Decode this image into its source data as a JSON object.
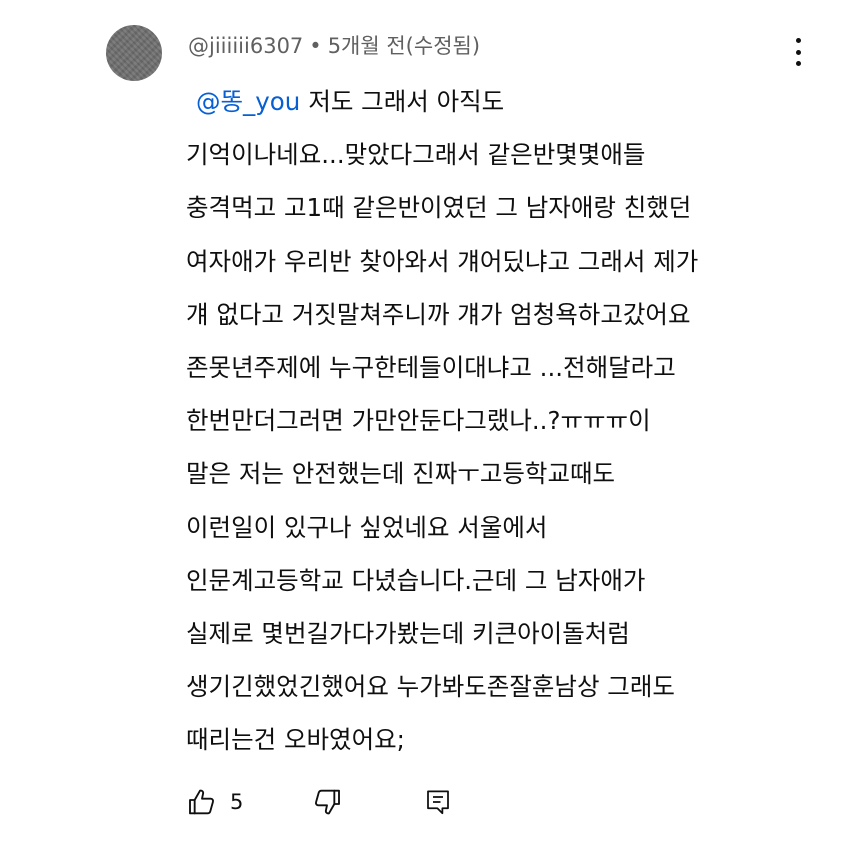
{
  "comment": {
    "author": "@jiiiiii6307",
    "separator": "•",
    "time": "5개월 전(수정됨)",
    "mention": "@똥_you",
    "first_line": "저도 그래서 아직도",
    "lines": [
      "기억이나네요...맞았다그래서 같은반몇몇애들",
      "충격먹고 고1때 같은반이였던 그 남자애랑 친했던",
      "여자애가 우리반 찾아와서 걔어딨냐고 그래서 제가",
      "걔 없다고 거짓말쳐주니까 걔가 엄청욕하고갔어요",
      "존못년주제에 누구한테들이대냐고 ...전해달라고",
      "한번만더그러면 가만안둔다그랬나..?ㅠㅠㅠ이",
      "말은 저는 안전했는데  진짜ㅜ고등학교때도",
      "이런일이 있구나 싶었네요 서울에서",
      "인문계고등학교 다녔습니다.근데 그 남자애가",
      "실제로 몇번길가다가봤는데 키큰아이돌처럼",
      "생기긴했었긴했어요 누가봐도존잘훈남상 그래도",
      "때리는건 오바였어요;"
    ],
    "like_count": "5"
  },
  "icons": {
    "more": "more-vert-icon",
    "like": "thumb-up-icon",
    "dislike": "thumb-down-icon",
    "reply": "reply-comment-icon"
  }
}
